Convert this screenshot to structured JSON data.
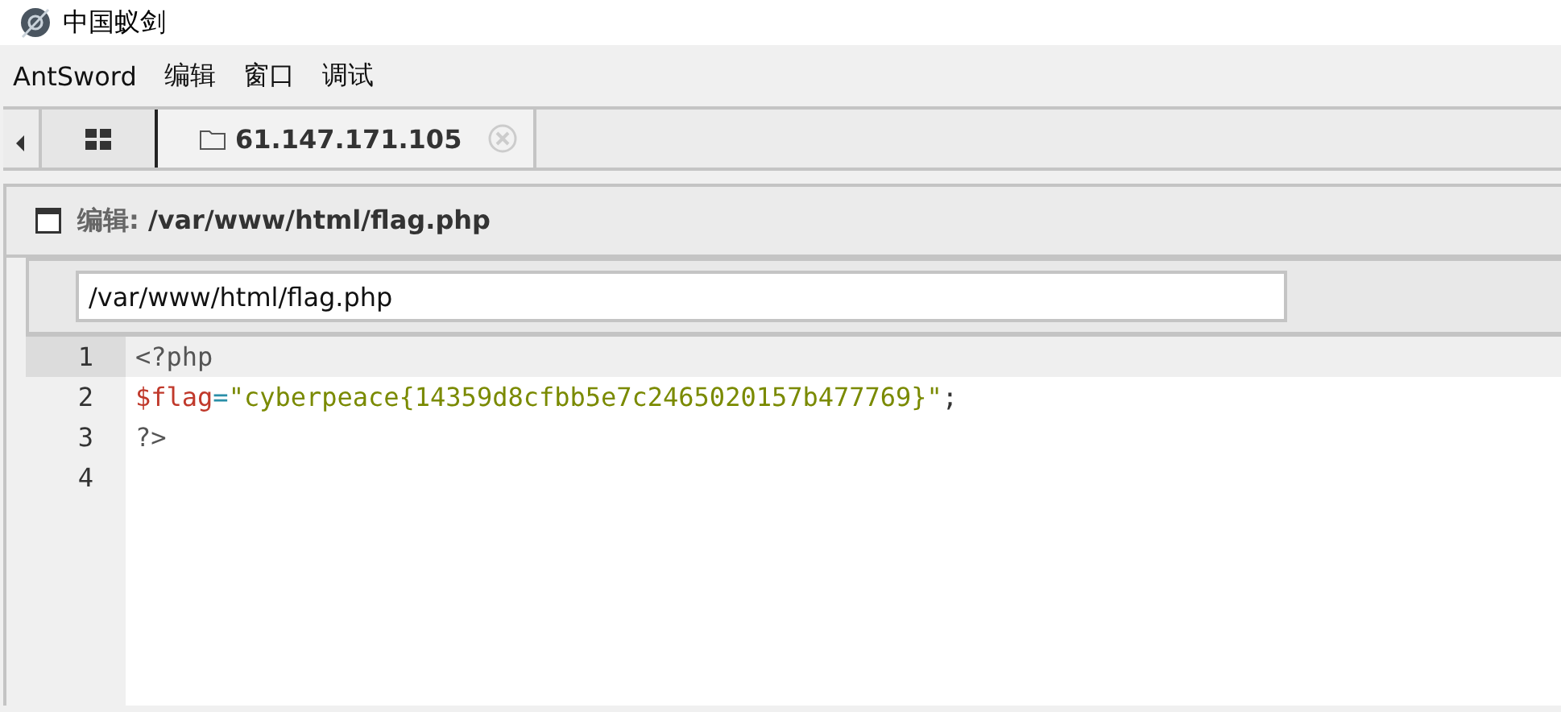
{
  "window": {
    "title": "中国蚁剑"
  },
  "menu": [
    "AntSword",
    "编辑",
    "窗口",
    "调试"
  ],
  "tabs": [
    {
      "kind": "grid",
      "selected": false
    },
    {
      "kind": "folder",
      "label": "61.147.171.105",
      "selected": true,
      "closable": true
    }
  ],
  "panel": {
    "title_prefix": "编辑:",
    "title_path": "/var/www/html/flag.php"
  },
  "path_field": {
    "value": "/var/www/html/flag.php"
  },
  "editor": {
    "lines": [
      {
        "number": "1",
        "active": true,
        "tokens": [
          {
            "kind": "meta",
            "text": "<?php"
          }
        ]
      },
      {
        "number": "2",
        "active": false,
        "tokens": [
          {
            "kind": "variable",
            "text": "$flag"
          },
          {
            "kind": "operator",
            "text": "="
          },
          {
            "kind": "string",
            "text": "\"cyberpeace{14359d8cfbb5e7c2465020157b477769}\""
          },
          {
            "kind": "punct",
            "text": ";"
          }
        ]
      },
      {
        "number": "3",
        "active": false,
        "tokens": [
          {
            "kind": "meta",
            "text": "?>"
          }
        ]
      },
      {
        "number": "4",
        "active": false
      }
    ]
  }
}
